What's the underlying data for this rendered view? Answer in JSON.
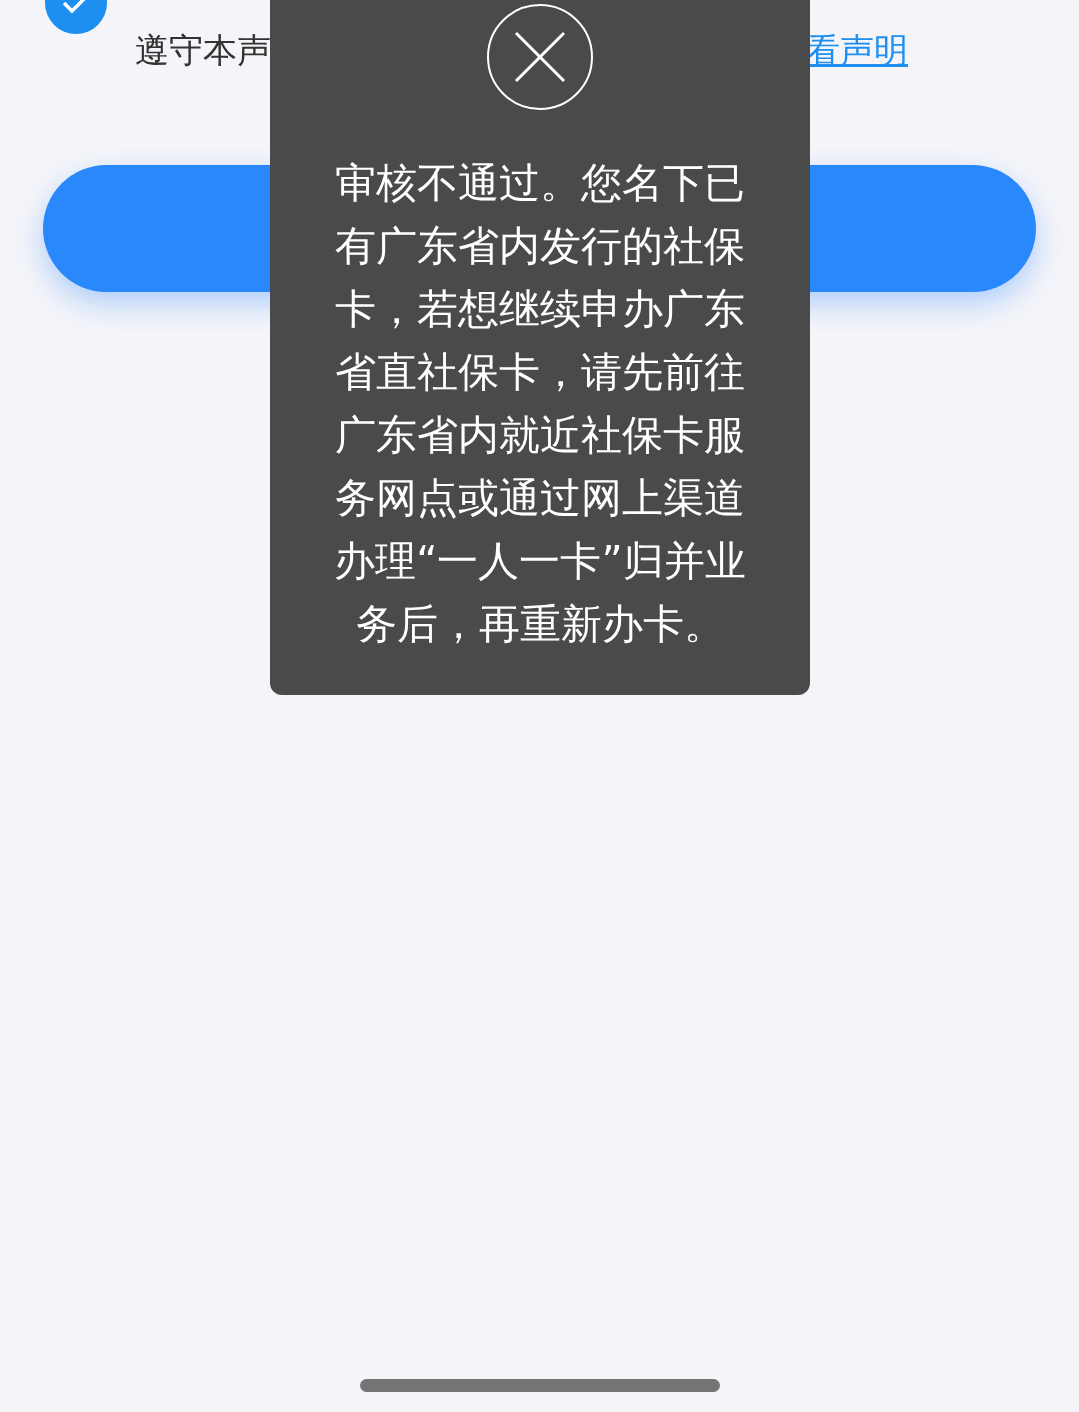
{
  "agreement": {
    "checked": true,
    "text": "遵守本声",
    "link": "看声明"
  },
  "submit_button": {
    "kind": "primary"
  },
  "toast": {
    "message": "审核不通过。您名下已有广东省内发行的社保卡，若想继续申办广东省直社保卡，请先前往广东省内就近社保卡服务网点或通过网上渠道办理“一人一卡”归并业务后，再重新办卡。"
  }
}
